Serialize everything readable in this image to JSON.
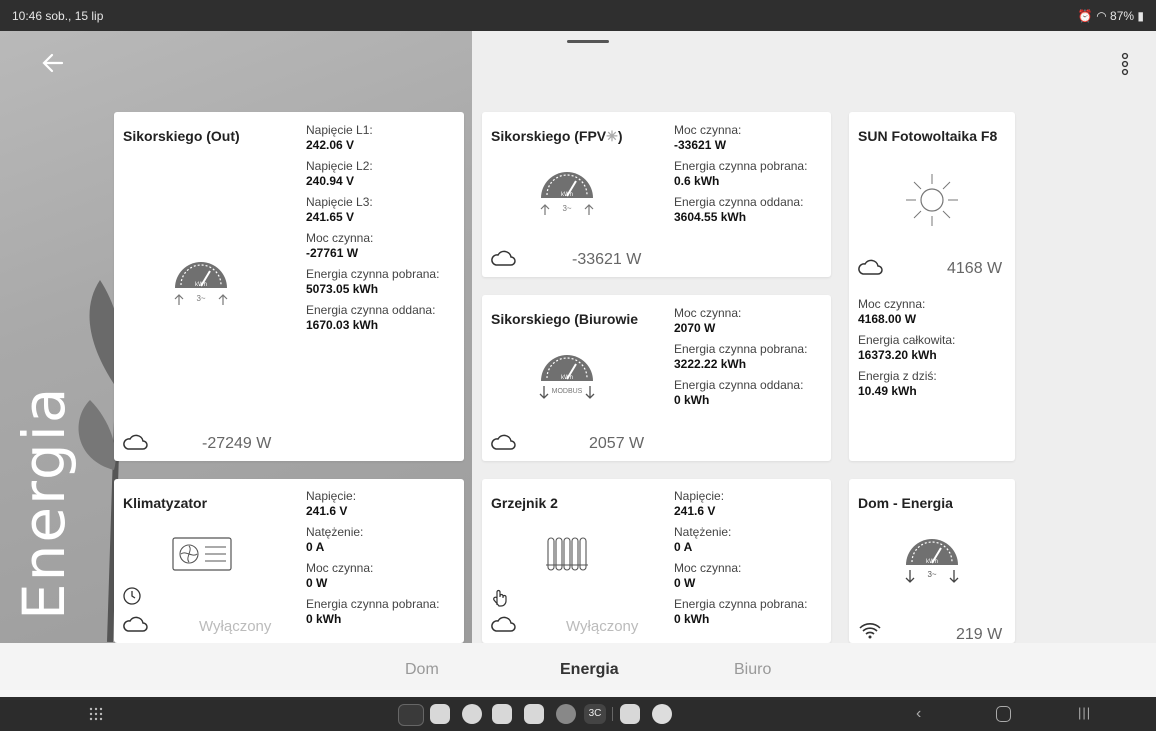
{
  "status": {
    "time": "10:46  sob., 15 lip",
    "battery": "87%"
  },
  "page": {
    "title": "Energia"
  },
  "cards": {
    "out": {
      "title": "Sikorskiego (Out)",
      "power": "-27249 W",
      "stats": [
        {
          "label": "Napięcie L1:",
          "value": "242.06 V"
        },
        {
          "label": "Napięcie L2:",
          "value": "240.94 V"
        },
        {
          "label": "Napięcie L3:",
          "value": "241.65 V"
        },
        {
          "label": "Moc czynna:",
          "value": "-27761 W"
        },
        {
          "label": "Energia czynna pobrana:",
          "value": "5073.05 kWh"
        },
        {
          "label": "Energia czynna oddana:",
          "value": "1670.03 kWh"
        }
      ],
      "meter_label": "kWh",
      "meter_sub": "3~"
    },
    "fpv": {
      "title": "Sikorskiego (FPV",
      "title_suffix": ")",
      "power": "-33621 W",
      "stats": [
        {
          "label": "Moc czynna:",
          "value": "-33621 W"
        },
        {
          "label": "Energia czynna pobrana:",
          "value": "0.6 kWh"
        },
        {
          "label": "Energia czynna oddana:",
          "value": "3604.55 kWh"
        }
      ],
      "meter_label": "kWh",
      "meter_sub": "3~"
    },
    "sun": {
      "title": "SUN Fotowoltaika F8",
      "power": "4168 W",
      "stats": [
        {
          "label": "Moc czynna:",
          "value": "4168.00 W"
        },
        {
          "label": "Energia całkowita:",
          "value": "16373.20 kWh"
        },
        {
          "label": "Energia z dziś:",
          "value": "10.49 kWh"
        }
      ]
    },
    "biuro": {
      "title": "Sikorskiego (Biurowie",
      "power": "2057 W",
      "stats": [
        {
          "label": "Moc czynna:",
          "value": "2070 W"
        },
        {
          "label": "Energia czynna pobrana:",
          "value": "3222.22 kWh"
        },
        {
          "label": "Energia czynna oddana:",
          "value": "0 kWh"
        }
      ],
      "meter_label": "kWh",
      "meter_sub": "MODBUS"
    },
    "klima": {
      "title": "Klimatyzator",
      "power": "Wyłączony",
      "stats": [
        {
          "label": "Napięcie:",
          "value": "241.6 V"
        },
        {
          "label": "Natężenie:",
          "value": "0 A"
        },
        {
          "label": "Moc czynna:",
          "value": "0 W"
        },
        {
          "label": "Energia czynna pobrana:",
          "value": "0 kWh"
        }
      ]
    },
    "grzejnik": {
      "title": "Grzejnik 2",
      "power": "Wyłączony",
      "stats": [
        {
          "label": "Napięcie:",
          "value": "241.6 V"
        },
        {
          "label": "Natężenie:",
          "value": "0 A"
        },
        {
          "label": "Moc czynna:",
          "value": "0 W"
        },
        {
          "label": "Energia czynna pobrana:",
          "value": "0 kWh"
        }
      ]
    },
    "dom": {
      "title": "Dom - Energia",
      "power": "219 W",
      "meter_label": "kWh",
      "meter_sub": "3~"
    }
  },
  "tabs": [
    {
      "label": "Dom"
    },
    {
      "label": "Energia"
    },
    {
      "label": "Biuro"
    }
  ],
  "navbar": {
    "app3": "3C"
  },
  "icons": [
    "back-arrow-icon",
    "more-vert-icon",
    "cloud-icon",
    "energy-meter-icon",
    "sun-icon",
    "air-conditioner-icon",
    "radiator-icon",
    "clock-icon",
    "hand-icon",
    "wifi-icon"
  ]
}
